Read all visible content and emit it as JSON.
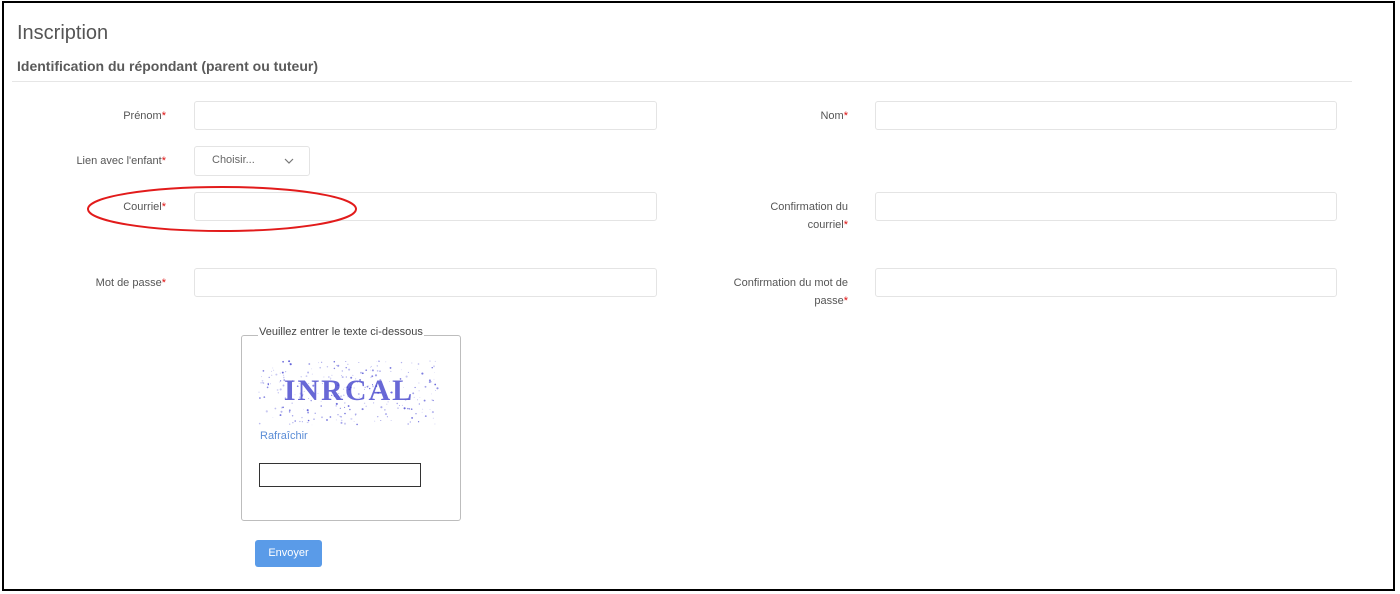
{
  "header": {
    "title": "Inscription",
    "subtitle": "Identification du répondant (parent ou tuteur)"
  },
  "form": {
    "required_marker": "*",
    "prenom_label": "Prénom",
    "nom_label": "Nom",
    "lien_label": "Lien avec l'enfant",
    "lien_value": "Choisir...",
    "courriel_label": "Courriel",
    "confirm_courriel_label_1": "Confirmation du",
    "confirm_courriel_label_2": "courriel",
    "password_label": "Mot de passe",
    "confirm_password_label_1": "Confirmation du mot de",
    "confirm_password_label_2": "passe",
    "prenom_value": "",
    "nom_value": "",
    "courriel_value": "",
    "confirm_courriel_value": "",
    "password_value": "",
    "confirm_password_value": ""
  },
  "captcha": {
    "legend": "Veuillez entrer le texte ci-dessous",
    "code_text": "INRCAL",
    "refresh_label": "Rafraîchir",
    "input_value": ""
  },
  "actions": {
    "submit_label": "Envoyer"
  },
  "colors": {
    "required": "#dd1111",
    "submit_bg": "#5a9be8",
    "link": "#5b8dd6",
    "annotation": "#e21b1b"
  },
  "icons": {
    "select_chevron": "chevron-down-icon"
  }
}
